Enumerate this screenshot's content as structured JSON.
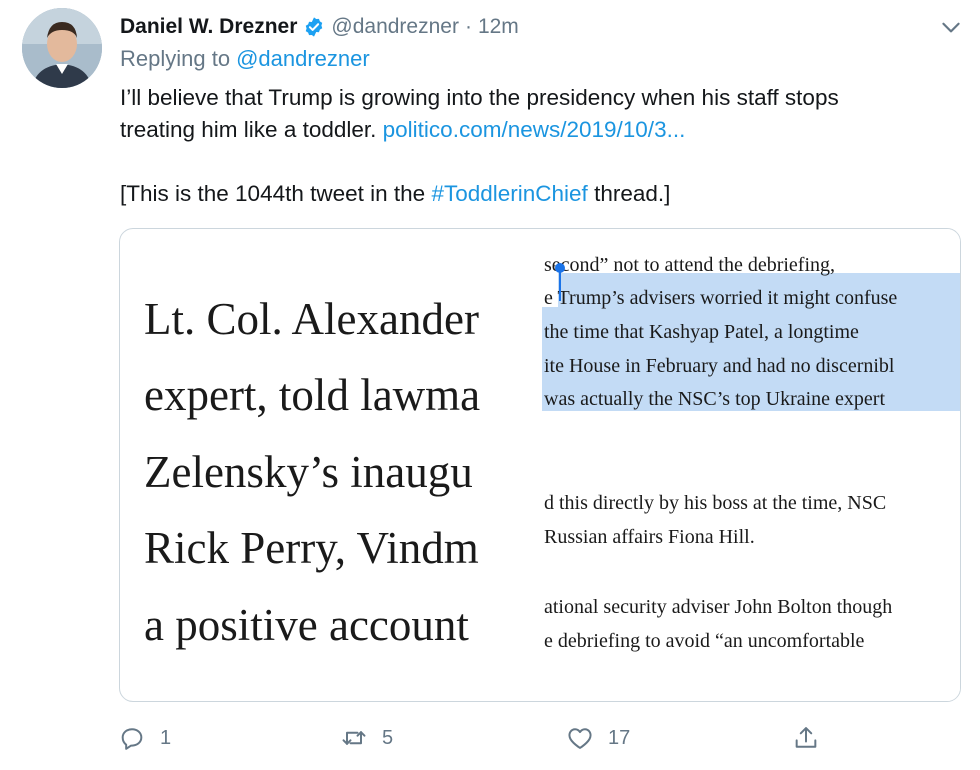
{
  "tweet": {
    "author_name": "Daniel W. Drezner",
    "author_handle": "@dandrezner",
    "separator": "·",
    "time": "12m",
    "replying_prefix": "Replying to",
    "replying_to": "@dandrezner",
    "text_line1": "I’ll believe that Trump is growing into the presidency when his staff stops",
    "text_line2_plain": "treating him like a toddler.",
    "text_link": "politico.com/news/2019/10/3...",
    "text_line3_pre": "[This is the 1044th tweet in the",
    "hashtag": "#ToddlerinChief",
    "text_line3_post": "thread.]"
  },
  "media": {
    "big_lines": [
      "Lt. Col. Alexander",
      "expert, told lawma",
      "Zelensky’s inaugu",
      "Rick Perry, Vindm",
      "a positive account"
    ],
    "small_lines": [
      "second” not to attend the debriefing,",
      "e Trump’s advisers worried it might confuse",
      "the time that Kashyap Patel, a longtime",
      "ite House in February and had no discernibl",
      "was actually the NSC’s top Ukraine expert",
      "d this directly by his boss at the time, NSC",
      "Russian affairs Fiona Hill.",
      "ational security adviser John Bolton though",
      "e debriefing to avoid “an uncomfortable"
    ]
  },
  "actions": {
    "reply_count": "1",
    "retweet_count": "5",
    "like_count": "17"
  },
  "colors": {
    "link": "#1b95e0",
    "secondary_text": "#657786",
    "selection": "#c3dbf5",
    "verified_badge": "#1da1f2"
  },
  "icons": [
    "avatar",
    "verified-badge-icon",
    "chevron-down-icon",
    "reply-icon",
    "retweet-icon",
    "like-icon",
    "share-icon"
  ]
}
